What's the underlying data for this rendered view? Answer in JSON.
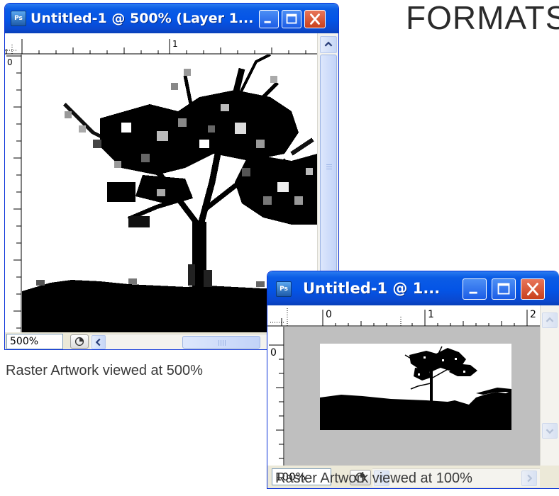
{
  "heading": {
    "text": "FORMATS"
  },
  "window_large": {
    "title": "Untitled-1 @ 500% (Layer 1...",
    "app_icon_text": "Ps",
    "ruler": {
      "top_labels": [
        "1"
      ],
      "left_labels": [
        "0"
      ]
    },
    "zoom_value": "500%",
    "caption": "Raster Artwork viewed at 500%"
  },
  "window_small": {
    "title": "Untitled-1 @ 1...",
    "app_icon_text": "Ps",
    "ruler": {
      "top_labels": [
        "0",
        "1",
        "2"
      ],
      "left_labels": [
        "0"
      ]
    },
    "zoom_value": "100%",
    "caption": "Raster Artwork viewed at 100%"
  },
  "colors": {
    "title_bar": "#0454e6",
    "window_frame": "#ece9d8",
    "close_button": "#d5502c",
    "canvas_background": "#bfbfbf"
  },
  "icons": [
    "photoshop-app-icon",
    "minimize-icon",
    "maximize-icon",
    "close-icon",
    "scroll-up-icon",
    "scroll-down-icon",
    "scroll-left-icon",
    "scroll-right-icon",
    "status-menu-icon"
  ]
}
